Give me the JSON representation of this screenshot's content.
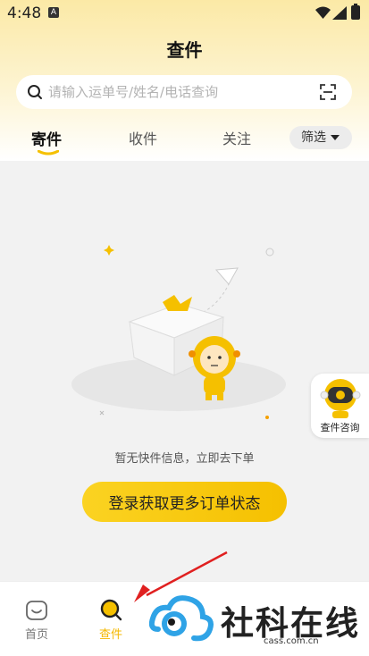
{
  "status_bar": {
    "time": "4:48",
    "notification": "A"
  },
  "header": {
    "title": "查件"
  },
  "search": {
    "placeholder": "请输入运单号/姓名/电话查询"
  },
  "tabs": [
    {
      "label": "寄件",
      "active": true
    },
    {
      "label": "收件",
      "active": false
    },
    {
      "label": "关注",
      "active": false
    }
  ],
  "filter": {
    "label": "筛选"
  },
  "empty_state": {
    "message": "暂无快件信息，立即去下单"
  },
  "login_button": {
    "label": "登录获取更多订单状态"
  },
  "float_consult": {
    "label": "查件咨询"
  },
  "bottom_nav": [
    {
      "label": "首页",
      "icon": "home-icon",
      "active": false
    },
    {
      "label": "查件",
      "icon": "search-package-icon",
      "active": true
    }
  ],
  "watermark": {
    "text": "社科在线",
    "url": "cass.com.cn"
  },
  "colors": {
    "accent": "#f5c000",
    "header_bg": "#fbe9a6",
    "active_nav": "#f5b800"
  }
}
